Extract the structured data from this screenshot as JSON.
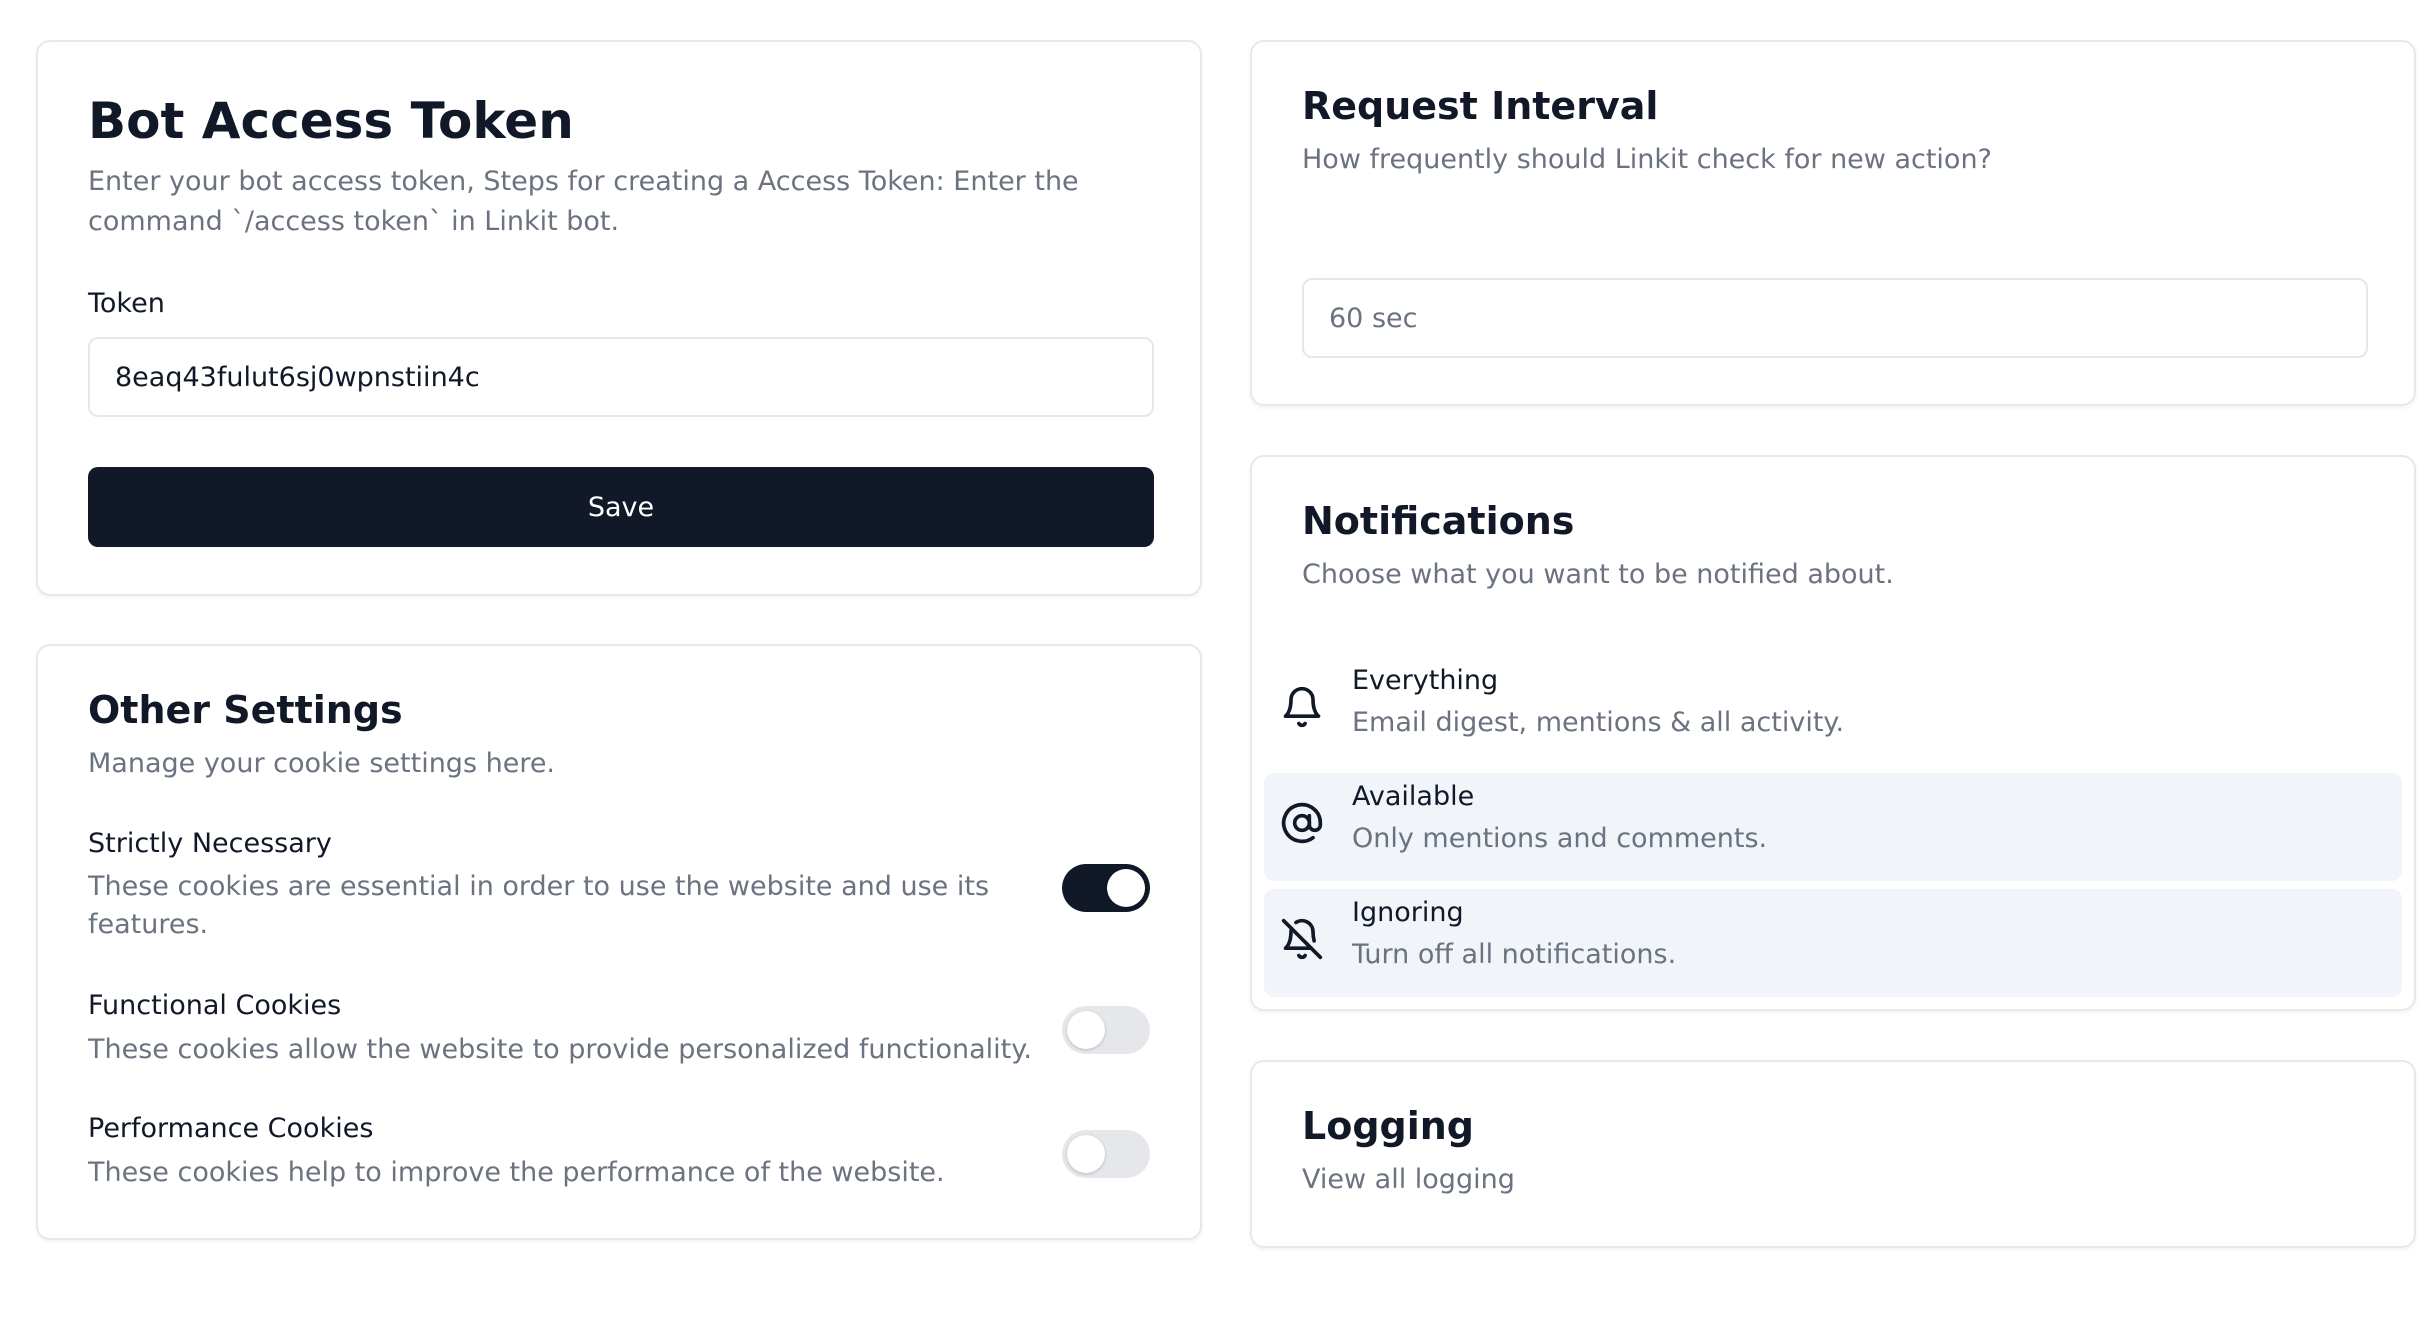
{
  "bot_token": {
    "title": "Bot Access Token",
    "description": "Enter your bot access token, Steps for creating a Access Token: Enter the command `/access token` in Linkit bot.",
    "token_label": "Token",
    "token_value": "8eaq43fulut6sj0wpnstiin4c",
    "save_label": "Save"
  },
  "other_settings": {
    "title": "Other Settings",
    "description": "Manage your cookie settings here.",
    "items": [
      {
        "title": "Strictly Necessary",
        "description": "These cookies are essential in order to use the website and use its features.",
        "enabled": true
      },
      {
        "title": "Functional Cookies",
        "description": "These cookies allow the website to provide personalized functionality.",
        "enabled": false
      },
      {
        "title": "Performance Cookies",
        "description": "These cookies help to improve the performance of the website.",
        "enabled": false
      }
    ]
  },
  "request_interval": {
    "title": "Request Interval",
    "description": "How frequently should Linkit check for new action?",
    "placeholder": "60 sec"
  },
  "notifications": {
    "title": "Notifications",
    "description": "Choose what you want to be notified about.",
    "options": [
      {
        "icon": "bell-icon",
        "title": "Everything",
        "description": "Email digest, mentions & all activity."
      },
      {
        "icon": "at-sign-icon",
        "title": "Available",
        "description": "Only mentions and comments."
      },
      {
        "icon": "bell-off-icon",
        "title": "Ignoring",
        "description": "Turn off all notifications."
      }
    ]
  },
  "logging": {
    "title": "Logging",
    "description": "View all logging"
  },
  "colors": {
    "primary": "#111827",
    "muted_text": "#6b7280",
    "border": "#e6e8ec",
    "highlight": "#f1f5f9"
  }
}
